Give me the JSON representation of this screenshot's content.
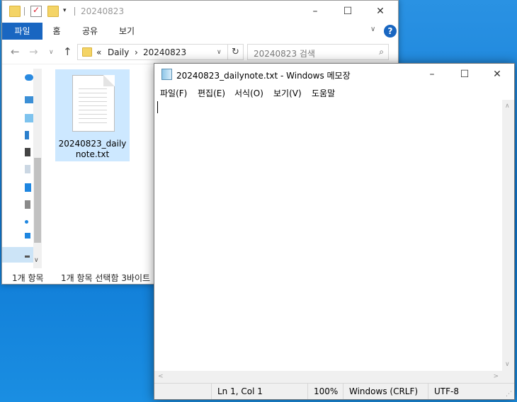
{
  "explorer": {
    "title": "20240823",
    "ribbon_tabs": [
      "파일",
      "홈",
      "공유",
      "보기"
    ],
    "help_label": "?",
    "address": {
      "overflow": "«",
      "crumb1": "Daily",
      "sep": "›",
      "crumb2": "20240823"
    },
    "search_placeholder": "20240823 검색",
    "file": {
      "name_line1": "20240823_daily",
      "name_line2": "note.txt"
    },
    "status_count": "1개 항목",
    "status_selection": "1개 항목 선택함 3바이트"
  },
  "notepad": {
    "title": "20240823_dailynote.txt - Windows 메모장",
    "menu": [
      "파일(F)",
      "편집(E)",
      "서식(O)",
      "보기(V)",
      "도움말"
    ],
    "content": "",
    "status": {
      "position": "Ln 1, Col 1",
      "zoom": "100%",
      "line_ending": "Windows (CRLF)",
      "encoding": "UTF-8"
    }
  },
  "colors": {
    "accent": "#1966c1",
    "desktop": "#1a82d8",
    "selection": "#cde8ff"
  },
  "icons": [
    "folder-icon",
    "checkmark-icon",
    "minimize-icon",
    "maximize-icon",
    "close-icon",
    "chevron-down-icon",
    "help-icon",
    "back-arrow-icon",
    "forward-arrow-icon",
    "up-arrow-icon",
    "refresh-icon",
    "search-icon",
    "text-file-icon",
    "notepad-icon"
  ]
}
